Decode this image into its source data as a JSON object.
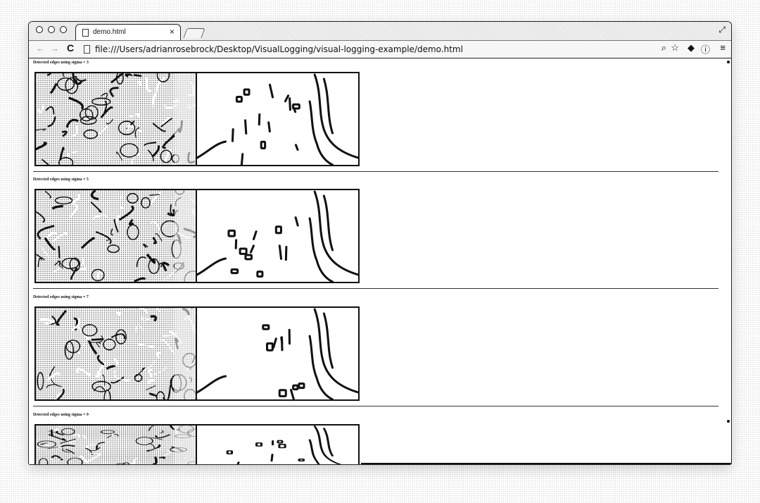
{
  "window": {
    "tab_title": "demo.html",
    "tab_close": "×",
    "fullscreen_glyph": "⤢"
  },
  "toolbar": {
    "back_glyph": "←",
    "forward_glyph": "→",
    "reload_glyph": "C",
    "url": "file:///Users/adrianrosebrock/Desktop/VisualLogging/visual-logging-example/demo.html",
    "search_glyph": "⌕",
    "star_glyph": "☆",
    "ext1_glyph": "◆",
    "info_glyph": "ⓘ",
    "menu_glyph": "≡"
  },
  "sections": [
    {
      "caption": "Detected edges using sigma = 3"
    },
    {
      "caption": "Detected edges using sigma = 5"
    },
    {
      "caption": "Detected edges using sigma = 7"
    },
    {
      "caption": "Detected edges using sigma = 9"
    }
  ],
  "icons": {
    "back": "arrow-left-icon",
    "forward": "arrow-right-icon",
    "reload": "reload-icon",
    "search": "search-icon",
    "star": "star-icon",
    "extension": "extension-icon",
    "info": "info-icon",
    "menu": "menu-icon"
  }
}
